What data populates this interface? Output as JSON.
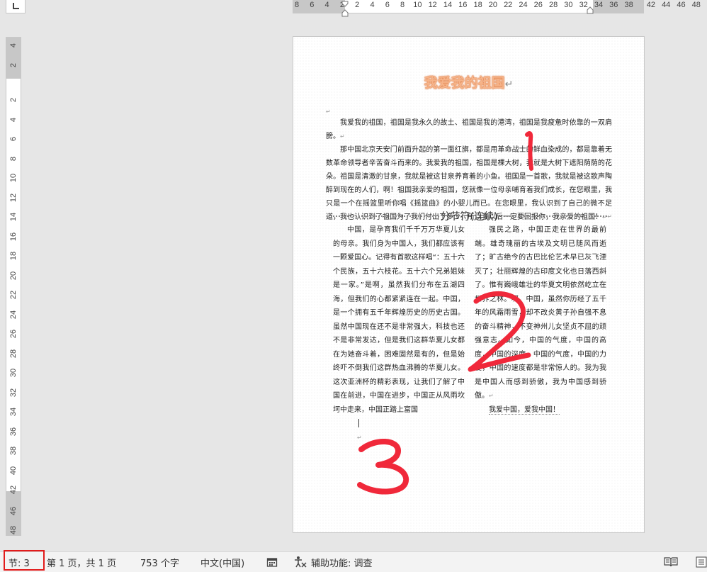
{
  "ruler": {
    "top_ticks": [
      "8",
      "6",
      "4",
      "2",
      "2",
      "4",
      "6",
      "8",
      "10",
      "12",
      "14",
      "16",
      "18",
      "20",
      "22",
      "24",
      "26",
      "28",
      "30",
      "32",
      "34",
      "36",
      "38",
      "42",
      "44",
      "46",
      "48"
    ],
    "left_ticks": [
      "4",
      "2",
      "2",
      "4",
      "6",
      "8",
      "10",
      "12",
      "14",
      "16",
      "18",
      "20",
      "22",
      "24",
      "26",
      "28",
      "30",
      "32",
      "34",
      "36",
      "38",
      "40",
      "42",
      "46",
      "48"
    ]
  },
  "document": {
    "title": "我爱我的祖国",
    "paragraphs": [
      "我爱我的祖国，祖国是我永久的故土、祖国是我的港湾，祖国是我疲惫时依靠的一双肩膀。",
      "那中国北京天安门前面升起的第一面红旗，都是用革命战士的鲜血染成的，都是靠着无数革命领导者辛苦奋斗而来的。我爱我的祖国，祖国是棵大树，我就是大树下遮阳荫荫的花朵。祖国是清澈的甘泉，我就是被这甘泉养育着的小鱼。祖国是一首歌，我就是被这歌声陶醉到现在的人们，啊！祖国我亲爱的祖国，您就像一位母亲哺育着我们成长，在您眼里，我只是一个在摇篮里听你唱《摇篮曲》的小婴儿而已。在您眼里，我认识到了自己的微不足道，我也认识到了祖国为了我们付出了多少，所以我以后一定要回报你，我亲爱的祖国！"
    ],
    "section_break_label": "分节符(连续)",
    "column1": "中国，是孕育我们千千万万华夏儿女的母亲。我们身为中国人，我们都应该有一颗爱国心。记得有首歌这样唱“：五十六个民族，五十六枝花。五十六个兄弟姐妹是一家。”是啊，虽然我们分布在五湖四海，但我们的心都紧紧连在一起。中国，是一个拥有五千年辉煌历史的历史古国。虽然中国现在还不是非常强大，科技也还不是非常发达，但是我们这群华夏儿女都在为她奋斗着，困难固然是有的，但是始终吓不倒我们这群热血沸腾的华夏儿女。这次亚洲杯的精彩表现，让我们了解了中国在前进，中国在进步，中国正从风雨坎坷中走来，中国正踏上富国",
    "column2": "强民之路，中国正走在世界的最前端。雄奇瑰丽的古埃及文明已随风而逝了；旷古绝今的古巴比伦艺术早已灰飞湮灭了；壮丽辉煌的古印度文化也日落西斜了。惟有巍峨雄壮的华夏文明依然屹立在世界之林。啊，中国，虽然你历经了五千年的风霜雨雪，却不改炎黄子孙自强不息的奋斗精神，不变神州儿女坚贞不屈的顽强意志。如今，中国的气度，中国的高度，中国的深度，中国的气度，中国的力度，中国的速度都是非常惊人的。我为我是中国人而感到骄傲，我为中国感到骄傲。",
    "column2_end": "我爱中国，爱我中国！",
    "annotations": [
      "1",
      "2",
      "3"
    ]
  },
  "statusbar": {
    "section": "节: 3",
    "page": "第 1 页，共 1 页",
    "words": "753 个字",
    "language": "中文(中国)",
    "accessibility": "辅助功能: 调查"
  },
  "colors": {
    "annotation_red": "#f0283a",
    "highlight_box": "#e21b1b",
    "title_orange": "#f6b48a"
  }
}
